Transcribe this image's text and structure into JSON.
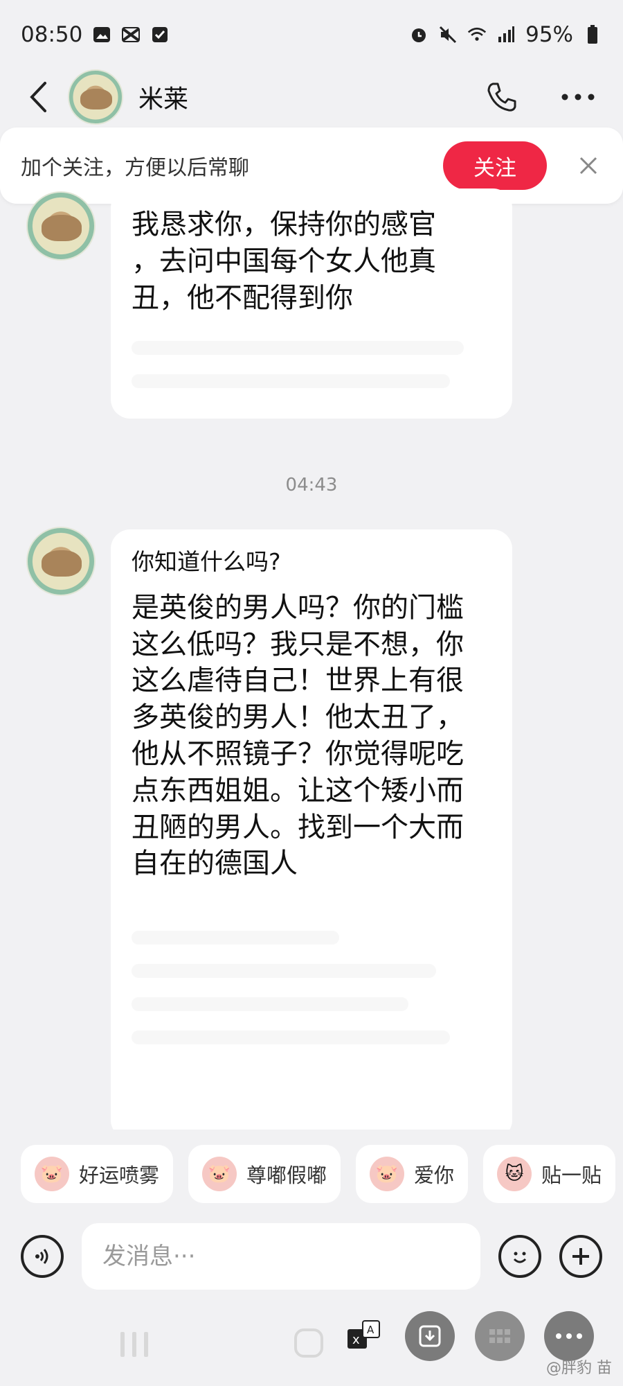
{
  "status_bar": {
    "time": "08:50",
    "battery": "95%",
    "icons_left": [
      "image-icon",
      "capcut-icon",
      "check-square-icon"
    ],
    "icons_right": [
      "alarm-icon",
      "mute-icon",
      "wifi-icon",
      "signal-icon",
      "battery-icon"
    ]
  },
  "header": {
    "contact_name": "米莱",
    "back_icon": "chevron-left-icon",
    "call_icon": "phone-icon",
    "more_icon": "more-horizontal-icon"
  },
  "follow_banner": {
    "text": "加个关注，方便以后常聊",
    "button_label": "关注",
    "close_icon": "close-icon"
  },
  "messages": [
    {
      "sender": "米莱",
      "text_lines": [
        "我恳求你，保持你的感官",
        "，去问中国每个女人他真",
        "丑，他不配得到你"
      ]
    },
    {
      "sender": "米莱",
      "intro": "你知道什么吗?",
      "text_lines": [
        "是英俊的男人吗？你的门槛",
        "这么低吗？我只是不想，你",
        "这么虐待自己！世界上有很",
        "多英俊的男人！他太丑了，",
        "他从不照镜子？你觉得呢吃",
        "点东西姐姐。让这个矮小而",
        "丑陋的男人。找到一个大而",
        "自在的德国人"
      ]
    }
  ],
  "timestamp": "04:43",
  "quick_replies": [
    {
      "label": "好运喷雾",
      "icon": "pig-icon"
    },
    {
      "label": "尊嘟假嘟",
      "icon": "pig-icon"
    },
    {
      "label": "爱你",
      "icon": "pig-icon"
    },
    {
      "label": "贴一贴",
      "icon": "cat-pig-icon"
    }
  ],
  "input": {
    "placeholder": "发消息···",
    "voice_icon": "voice-icon",
    "emoji_icon": "smile-icon",
    "add_icon": "plus-icon"
  },
  "bottom_nav": {
    "recent_icon": "recent-apps-icon",
    "home_icon": "home-icon",
    "translate_icon": "translate-icon",
    "download_icon": "download-icon",
    "grid_icon": "grid-icon",
    "more_icon": "more-horizontal-icon"
  },
  "watermark": "@胖豹 苗"
}
